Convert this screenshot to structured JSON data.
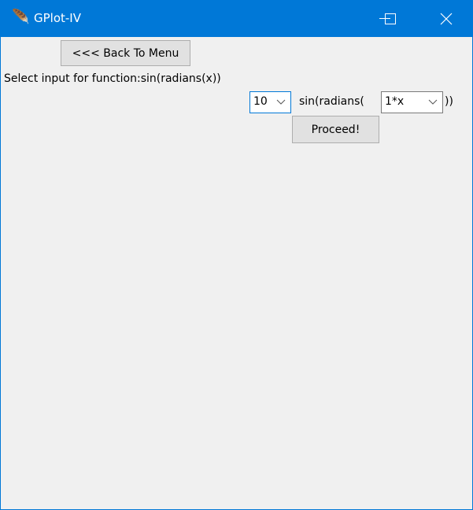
{
  "window": {
    "title": "GPlot-IV",
    "accent": "#0078d7"
  },
  "back_button": "<<< Back To Menu",
  "prompt": "Select input for function:sin(radians(x))",
  "count_combo": {
    "value": "10"
  },
  "func_prefix": "sin(radians(",
  "expr_combo": {
    "value": "1*x"
  },
  "func_suffix": "))",
  "proceed_button": "Proceed!"
}
